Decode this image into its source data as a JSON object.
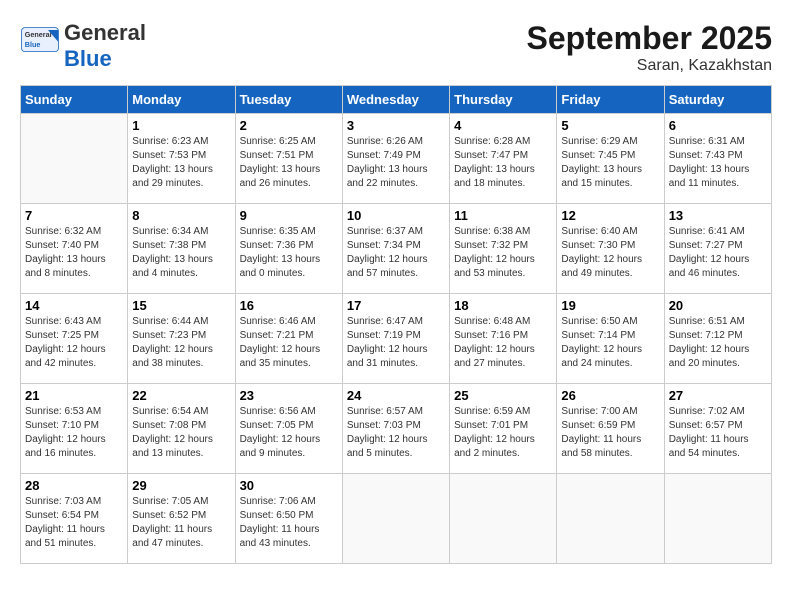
{
  "header": {
    "logo_general": "General",
    "logo_blue": "Blue",
    "main_title": "September 2025",
    "subtitle": "Saran, Kazakhstan"
  },
  "calendar": {
    "weekdays": [
      "Sunday",
      "Monday",
      "Tuesday",
      "Wednesday",
      "Thursday",
      "Friday",
      "Saturday"
    ],
    "weeks": [
      [
        {
          "day": "",
          "sunrise": "",
          "sunset": "",
          "daylight": ""
        },
        {
          "day": "1",
          "sunrise": "Sunrise: 6:23 AM",
          "sunset": "Sunset: 7:53 PM",
          "daylight": "Daylight: 13 hours and 29 minutes."
        },
        {
          "day": "2",
          "sunrise": "Sunrise: 6:25 AM",
          "sunset": "Sunset: 7:51 PM",
          "daylight": "Daylight: 13 hours and 26 minutes."
        },
        {
          "day": "3",
          "sunrise": "Sunrise: 6:26 AM",
          "sunset": "Sunset: 7:49 PM",
          "daylight": "Daylight: 13 hours and 22 minutes."
        },
        {
          "day": "4",
          "sunrise": "Sunrise: 6:28 AM",
          "sunset": "Sunset: 7:47 PM",
          "daylight": "Daylight: 13 hours and 18 minutes."
        },
        {
          "day": "5",
          "sunrise": "Sunrise: 6:29 AM",
          "sunset": "Sunset: 7:45 PM",
          "daylight": "Daylight: 13 hours and 15 minutes."
        },
        {
          "day": "6",
          "sunrise": "Sunrise: 6:31 AM",
          "sunset": "Sunset: 7:43 PM",
          "daylight": "Daylight: 13 hours and 11 minutes."
        }
      ],
      [
        {
          "day": "7",
          "sunrise": "Sunrise: 6:32 AM",
          "sunset": "Sunset: 7:40 PM",
          "daylight": "Daylight: 13 hours and 8 minutes."
        },
        {
          "day": "8",
          "sunrise": "Sunrise: 6:34 AM",
          "sunset": "Sunset: 7:38 PM",
          "daylight": "Daylight: 13 hours and 4 minutes."
        },
        {
          "day": "9",
          "sunrise": "Sunrise: 6:35 AM",
          "sunset": "Sunset: 7:36 PM",
          "daylight": "Daylight: 13 hours and 0 minutes."
        },
        {
          "day": "10",
          "sunrise": "Sunrise: 6:37 AM",
          "sunset": "Sunset: 7:34 PM",
          "daylight": "Daylight: 12 hours and 57 minutes."
        },
        {
          "day": "11",
          "sunrise": "Sunrise: 6:38 AM",
          "sunset": "Sunset: 7:32 PM",
          "daylight": "Daylight: 12 hours and 53 minutes."
        },
        {
          "day": "12",
          "sunrise": "Sunrise: 6:40 AM",
          "sunset": "Sunset: 7:30 PM",
          "daylight": "Daylight: 12 hours and 49 minutes."
        },
        {
          "day": "13",
          "sunrise": "Sunrise: 6:41 AM",
          "sunset": "Sunset: 7:27 PM",
          "daylight": "Daylight: 12 hours and 46 minutes."
        }
      ],
      [
        {
          "day": "14",
          "sunrise": "Sunrise: 6:43 AM",
          "sunset": "Sunset: 7:25 PM",
          "daylight": "Daylight: 12 hours and 42 minutes."
        },
        {
          "day": "15",
          "sunrise": "Sunrise: 6:44 AM",
          "sunset": "Sunset: 7:23 PM",
          "daylight": "Daylight: 12 hours and 38 minutes."
        },
        {
          "day": "16",
          "sunrise": "Sunrise: 6:46 AM",
          "sunset": "Sunset: 7:21 PM",
          "daylight": "Daylight: 12 hours and 35 minutes."
        },
        {
          "day": "17",
          "sunrise": "Sunrise: 6:47 AM",
          "sunset": "Sunset: 7:19 PM",
          "daylight": "Daylight: 12 hours and 31 minutes."
        },
        {
          "day": "18",
          "sunrise": "Sunrise: 6:48 AM",
          "sunset": "Sunset: 7:16 PM",
          "daylight": "Daylight: 12 hours and 27 minutes."
        },
        {
          "day": "19",
          "sunrise": "Sunrise: 6:50 AM",
          "sunset": "Sunset: 7:14 PM",
          "daylight": "Daylight: 12 hours and 24 minutes."
        },
        {
          "day": "20",
          "sunrise": "Sunrise: 6:51 AM",
          "sunset": "Sunset: 7:12 PM",
          "daylight": "Daylight: 12 hours and 20 minutes."
        }
      ],
      [
        {
          "day": "21",
          "sunrise": "Sunrise: 6:53 AM",
          "sunset": "Sunset: 7:10 PM",
          "daylight": "Daylight: 12 hours and 16 minutes."
        },
        {
          "day": "22",
          "sunrise": "Sunrise: 6:54 AM",
          "sunset": "Sunset: 7:08 PM",
          "daylight": "Daylight: 12 hours and 13 minutes."
        },
        {
          "day": "23",
          "sunrise": "Sunrise: 6:56 AM",
          "sunset": "Sunset: 7:05 PM",
          "daylight": "Daylight: 12 hours and 9 minutes."
        },
        {
          "day": "24",
          "sunrise": "Sunrise: 6:57 AM",
          "sunset": "Sunset: 7:03 PM",
          "daylight": "Daylight: 12 hours and 5 minutes."
        },
        {
          "day": "25",
          "sunrise": "Sunrise: 6:59 AM",
          "sunset": "Sunset: 7:01 PM",
          "daylight": "Daylight: 12 hours and 2 minutes."
        },
        {
          "day": "26",
          "sunrise": "Sunrise: 7:00 AM",
          "sunset": "Sunset: 6:59 PM",
          "daylight": "Daylight: 11 hours and 58 minutes."
        },
        {
          "day": "27",
          "sunrise": "Sunrise: 7:02 AM",
          "sunset": "Sunset: 6:57 PM",
          "daylight": "Daylight: 11 hours and 54 minutes."
        }
      ],
      [
        {
          "day": "28",
          "sunrise": "Sunrise: 7:03 AM",
          "sunset": "Sunset: 6:54 PM",
          "daylight": "Daylight: 11 hours and 51 minutes."
        },
        {
          "day": "29",
          "sunrise": "Sunrise: 7:05 AM",
          "sunset": "Sunset: 6:52 PM",
          "daylight": "Daylight: 11 hours and 47 minutes."
        },
        {
          "day": "30",
          "sunrise": "Sunrise: 7:06 AM",
          "sunset": "Sunset: 6:50 PM",
          "daylight": "Daylight: 11 hours and 43 minutes."
        },
        {
          "day": "",
          "sunrise": "",
          "sunset": "",
          "daylight": ""
        },
        {
          "day": "",
          "sunrise": "",
          "sunset": "",
          "daylight": ""
        },
        {
          "day": "",
          "sunrise": "",
          "sunset": "",
          "daylight": ""
        },
        {
          "day": "",
          "sunrise": "",
          "sunset": "",
          "daylight": ""
        }
      ]
    ]
  }
}
